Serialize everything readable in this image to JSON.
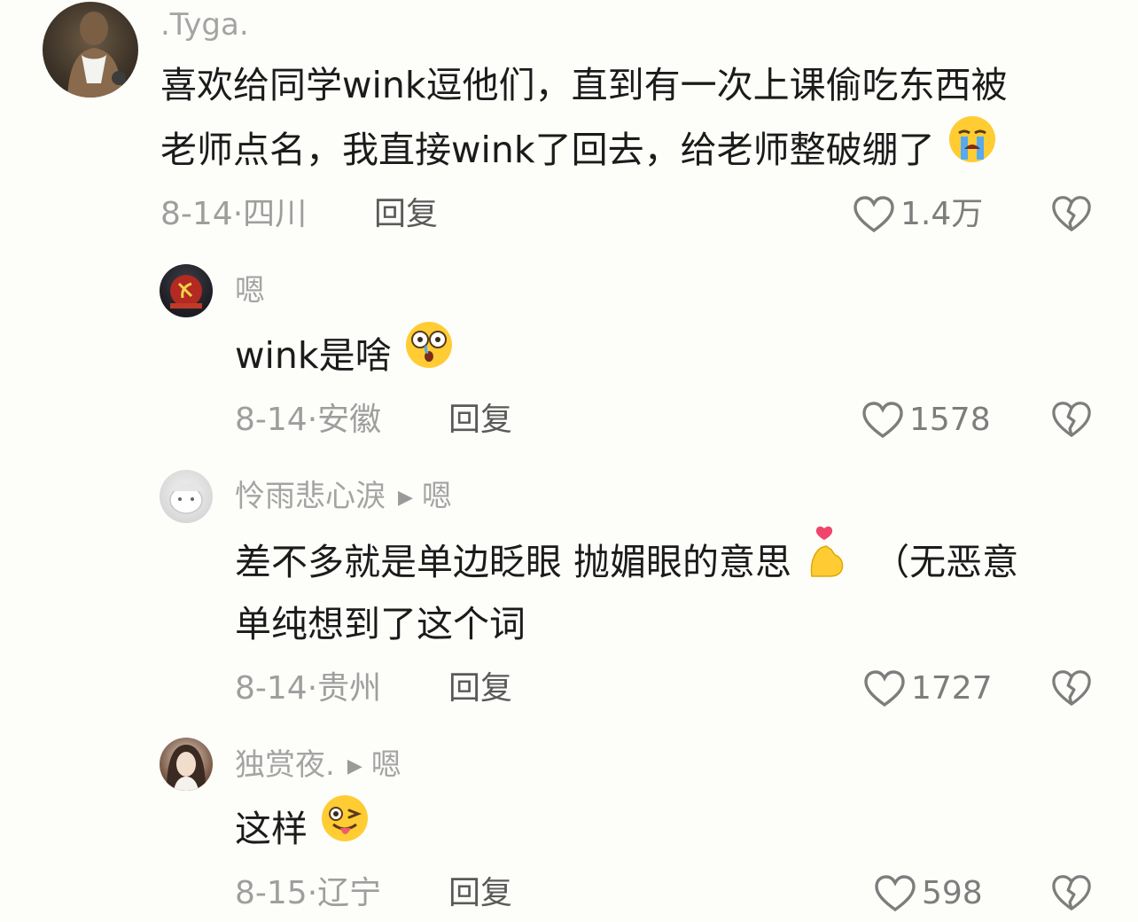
{
  "comments": [
    {
      "username": ".Tyga.",
      "line1": "喜欢给同学wink逗他们，直到有一次上课偷吃东西被",
      "line2": "老师点名，我直接wink了回去，给老师整破绷了",
      "emoji": "crying-face-emoji",
      "date": "8-14",
      "location": "四川",
      "reply_label": "回复",
      "likes": "1.4万"
    }
  ],
  "replies": [
    {
      "username": "嗯",
      "line1": "wink是啥",
      "emoji": "flushed-face-emoji",
      "date": "8-14",
      "location": "安徽",
      "reply_label": "回复",
      "likes": "1578"
    },
    {
      "username": "怜雨悲心淚",
      "reply_to": "嗯",
      "line1": "差不多就是单边眨眼 抛媚眼的意思",
      "line1_tail": "（无恶意",
      "line2": "单纯想到了这个词",
      "emoji": "finger-heart-emoji",
      "date": "8-14",
      "location": "贵州",
      "reply_label": "回复",
      "likes": "1727"
    },
    {
      "username": "独赏夜.",
      "reply_to": "嗯",
      "line1": "这样",
      "emoji": "winking-tongue-face-emoji",
      "date": "8-15",
      "location": "辽宁",
      "reply_label": "回复",
      "likes": "598"
    }
  ],
  "colors": {
    "background": "#fdfdfa",
    "text": "#1b1b1b",
    "muted": "#a4a4a4",
    "icon": "#7d7d7d"
  }
}
